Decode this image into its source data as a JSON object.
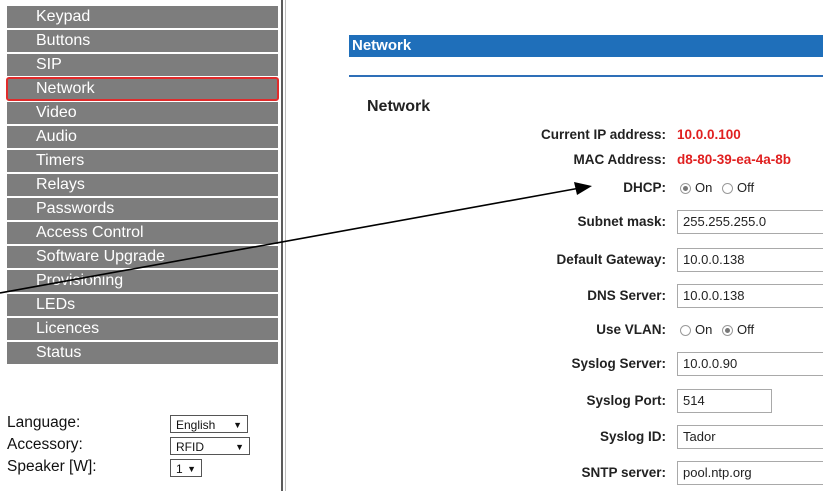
{
  "sidebar": {
    "items": [
      {
        "label": "Keypad"
      },
      {
        "label": "Buttons"
      },
      {
        "label": "SIP"
      },
      {
        "label": "Network"
      },
      {
        "label": "Video"
      },
      {
        "label": "Audio"
      },
      {
        "label": "Timers"
      },
      {
        "label": "Relays"
      },
      {
        "label": "Passwords"
      },
      {
        "label": "Access Control"
      },
      {
        "label": "Software Upgrade"
      },
      {
        "label": "Provisioning"
      },
      {
        "label": "LEDs"
      },
      {
        "label": "Licences"
      },
      {
        "label": "Status"
      }
    ],
    "active_item": "Network",
    "settings": {
      "language_label": "Language:",
      "language_value": "English",
      "accessory_label": "Accessory:",
      "accessory_value": "RFID",
      "speaker_label": "Speaker [W]:",
      "speaker_value": "1"
    }
  },
  "main": {
    "header": "Network",
    "section_title": "Network",
    "fields": {
      "current_ip_label": "Current IP address:",
      "current_ip_value": "10.0.0.100",
      "mac_label": "MAC Address:",
      "mac_value": "d8-80-39-ea-4a-8b",
      "dhcp_label": "DHCP:",
      "dhcp_on": "On",
      "dhcp_off": "Off",
      "dhcp_selected": "On",
      "subnet_label": "Subnet mask:",
      "subnet_value": "255.255.255.0",
      "gateway_label": "Default Gateway:",
      "gateway_value": "10.0.0.138",
      "dns_label": "DNS Server:",
      "dns_value": "10.0.0.138",
      "vlan_label": "Use VLAN:",
      "vlan_on": "On",
      "vlan_off": "Off",
      "vlan_selected": "Off",
      "syslog_server_label": "Syslog Server:",
      "syslog_server_value": "10.0.0.90",
      "syslog_port_label": "Syslog Port:",
      "syslog_port_value": "514",
      "syslog_id_label": "Syslog ID:",
      "syslog_id_value": "Tador",
      "sntp_label": "SNTP server:",
      "sntp_value": "pool.ntp.org"
    }
  },
  "colors": {
    "header_blue": "#1f6fba",
    "highlight_red": "#e02b2b",
    "menu_gray": "#7d7d7d",
    "value_red": "#e02020"
  }
}
